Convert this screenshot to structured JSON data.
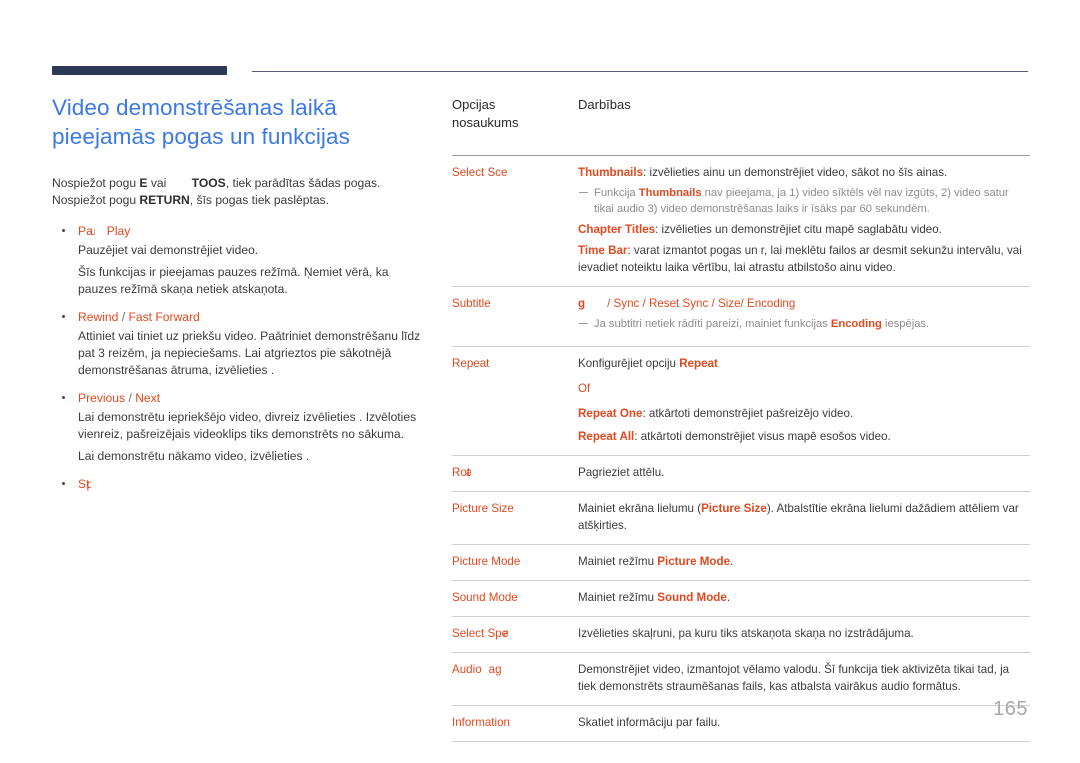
{
  "colors": {
    "heading_blue": "#3b7ae4",
    "accent_orange": "#e1491f",
    "rule_navy": "#2e3a55",
    "body_gray": "#3c3c3c",
    "note_gray": "#8c8c8c",
    "page_number_gray": "#a8a8a8"
  },
  "heading": {
    "line1": "Video demonstrēšanas laikā",
    "line2": "pieejamās pogas un funkcijas"
  },
  "intro": {
    "part1": "Nospiežot pogu ",
    "bold1": "E",
    "part2": " vai ",
    "bold2": "TOOS",
    "part3": ", tiek parādītas šādas pogas. Nospiežot pogu ",
    "bold3": "RETURN",
    "part4": ", šīs pogas tiek paslēptas."
  },
  "bullets": [
    {
      "head_left": "Pa",
      "head_glyph": "u",
      "head_sep": "/",
      "head_right": "Play",
      "lines": [
        "Pauzējiet vai demonstrējiet video.",
        "Šīs funkcijas ir pieejamas pauzes režīmā. Ņemiet vērā, ka pauzes režīmā skaņa netiek atskaņota."
      ]
    },
    {
      "head_left": "Rewind",
      "head_sep": "/",
      "head_right": "Fast Forward",
      "lines": [
        "Attiniet vai tiniet uz priekšu video. Paātriniet demonstrēšanu līdz pat 3 reizēm, ja nepieciešams. Lai atgrieztos pie sākotnējā demonstrēšanas ātruma, izvēlieties ."
      ]
    },
    {
      "head_left": "Previous",
      "head_sep": "/",
      "head_right": "Next",
      "lines": [
        "Lai demonstrētu iepriekšējo video, divreiz izvēlieties . Izvēloties vienreiz, pašreizējais videoklips tiks demonstrēts no sākuma.",
        "Lai demonstrētu nākamo video, izvēlieties ."
      ]
    },
    {
      "head_left": "St",
      "head_glyph": "p",
      "head_sep": "",
      "head_right": "",
      "lines": []
    }
  ],
  "table": {
    "headers": {
      "col1_line1": "Opcijas",
      "col1_line2": "nosaukums",
      "col2": "Darbības"
    },
    "rows": [
      {
        "name": "Select Sce",
        "blocks": [
          {
            "type": "kv",
            "key": "Thumbnails",
            "text": ": izvēlieties ainu un demonstrējiet video, sākot no šīs ainas."
          },
          {
            "type": "note",
            "pre": "Funkcija ",
            "key": "Thumbnails",
            "text": " nav pieejama, ja 1) video sīktēls vēl nav izgūts, 2) video satur tikai audio 3) video demonstrēšanas laiks ir īsāks par 60 sekundēm."
          },
          {
            "type": "kv",
            "key": "Chapter Titles",
            "text": ": izvēlieties un demonstrējiet citu mapē saglabātu video."
          },
          {
            "type": "kv",
            "key": "Time Bar",
            "text": ": varat izmantot pogas un  r, lai meklētu failos ar desmit sekunžu intervālu, vai ievadiet noteiktu laika vērtību, lai atrastu atbilstošo ainu video."
          }
        ]
      },
      {
        "name": "Subtitle",
        "blocks": [
          {
            "type": "opts",
            "glyph": "g",
            "options": [
              "/ Sync",
              "/ Reset Sync",
              "/ Size",
              "/  Encoding"
            ]
          },
          {
            "type": "note",
            "pre": "Ja subtitri netiek rādīti pareizi, mainiet funkcijas ",
            "key": "Encoding",
            "text": " iespējas."
          }
        ]
      },
      {
        "name": "Repeat",
        "blocks": [
          {
            "type": "kv-tail",
            "pre": "Konfigurējiet opciju ",
            "key": "Repeat",
            "text": ""
          },
          {
            "type": "key-only",
            "key": "Of"
          },
          {
            "type": "kv",
            "key": "Repeat One",
            "text": ": atkārtoti demonstrējiet pašreizējo video."
          },
          {
            "type": "kv",
            "key": "Repeat All",
            "text": ": atkārtoti demonstrējiet visus mapē esošos video."
          }
        ]
      },
      {
        "name": "Rot",
        "name_glyph": "a",
        "blocks": [
          {
            "type": "plain",
            "text": "Pagrieziet attēlu."
          }
        ]
      },
      {
        "name": "Picture Size",
        "blocks": [
          {
            "type": "kv-mid",
            "pre": "Mainiet ekrāna lielumu (",
            "key": "Picture Size",
            "text": "). Atbalstītie ekrāna lielumi dažādiem attēliem var atšķirties."
          }
        ]
      },
      {
        "name": "Picture Mode",
        "blocks": [
          {
            "type": "kv-mid",
            "pre": "Mainiet režīmu ",
            "key": "Picture Mode",
            "text": "."
          }
        ]
      },
      {
        "name": "Sound Mode",
        "blocks": [
          {
            "type": "kv-mid",
            "pre": "Mainiet režīmu ",
            "key": "Sound Mode",
            "text": "."
          }
        ]
      },
      {
        "name": "Select Spe",
        "name_glyph": "a",
        "blocks": [
          {
            "type": "plain",
            "text": "Izvēlieties skaļruni, pa kuru tiks atskaņota skaņa no izstrādājuma."
          }
        ]
      },
      {
        "name": "Audio",
        "name_glyph": "ag",
        "blocks": [
          {
            "type": "plain",
            "text": "Demonstrējiet video, izmantojot vēlamo valodu. Šī funkcija tiek aktivizēta tikai tad, ja tiek demonstrēts straumēšanas fails, kas atbalsta vairākus audio formātus."
          }
        ]
      },
      {
        "name": "Information",
        "blocks": [
          {
            "type": "plain",
            "text": "Skatiet informāciju par failu."
          }
        ]
      }
    ]
  },
  "page_number": "165"
}
